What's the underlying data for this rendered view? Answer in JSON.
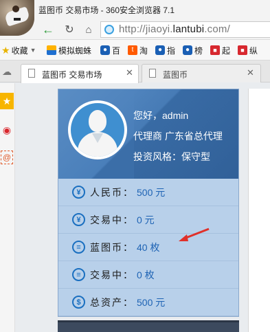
{
  "window": {
    "title": "蓝图币 交易市场 - 360安全浏览器 7.1"
  },
  "navbar": {
    "back_icon": "arrow-left-icon",
    "reload_icon": "reload-icon",
    "home_icon": "home-icon",
    "url_prefix": "http://jiaoyi.",
    "url_domain": "lantubi",
    "url_suffix": ".com/"
  },
  "bookmarks": {
    "items": [
      {
        "label": "收藏",
        "icon": "star-icon"
      },
      {
        "label": "模拟蜘蛛",
        "icon": "flag-icon"
      },
      {
        "label": "百",
        "icon": "baidu-paw-icon"
      },
      {
        "label": "淘",
        "icon": "taobao-icon"
      },
      {
        "label": "指",
        "icon": "baidu-paw-icon"
      },
      {
        "label": "榜",
        "icon": "baidu-paw-icon"
      },
      {
        "label": "起",
        "icon": "red-square-icon"
      },
      {
        "label": "纵",
        "icon": "red-square-icon"
      }
    ]
  },
  "tabs": [
    {
      "label": "蓝图币 交易市场",
      "active": true
    },
    {
      "label": "蓝图币",
      "active": false
    }
  ],
  "account": {
    "greeting": "您好，admin",
    "agent": "代理商 广东省总代理",
    "style": "投资风格：保守型",
    "rows": [
      {
        "icon": "yen-icon",
        "label": "人民币：",
        "value": "500 元"
      },
      {
        "icon": "yen-icon",
        "label": "交易中：",
        "value": "0 元"
      },
      {
        "icon": "coins-icon",
        "label": "蓝图币：",
        "value": "40 枚"
      },
      {
        "icon": "coins-icon",
        "label": "交易中：",
        "value": "0 枚"
      },
      {
        "icon": "money-bag-icon",
        "label": "总资产：",
        "value": "500 元"
      }
    ]
  },
  "colors": {
    "accent": "#1e63b4",
    "panel_header": "#4a7fba",
    "panel_body": "#b8d0ea",
    "annotation_arrow": "#e0302a"
  }
}
